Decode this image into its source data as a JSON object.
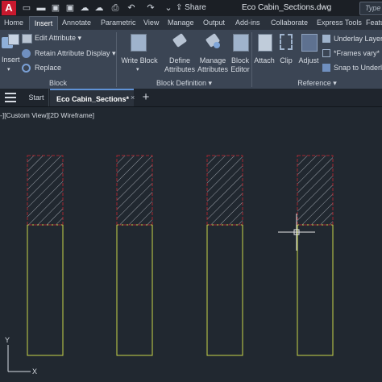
{
  "app": {
    "logo_letter": "A",
    "title": "Eco Cabin_Sections.dwg",
    "share_label": "Share",
    "search_placeholder": "Type a"
  },
  "quick_access": [
    "new-icon",
    "open-icon",
    "save-icon",
    "save-as-icon",
    "cloud-icon",
    "cloud-upload-icon",
    "print-icon",
    "undo-icon",
    "redo-icon",
    "workspace-dropdown-icon"
  ],
  "ribbon_tabs": [
    "Home",
    "Insert",
    "Annotate",
    "Parametric",
    "View",
    "Manage",
    "Output",
    "Add-ins",
    "Collaborate",
    "Express Tools",
    "Featu"
  ],
  "active_tab": "Insert",
  "ribbon": {
    "block_panel": {
      "title": "Block",
      "insert_label": "Insert",
      "edit_attribute": "Edit Attribute",
      "retain_attribute_display": "Retain Attribute Display",
      "replace": "Replace"
    },
    "block_definition_panel": {
      "title": "Block Definition",
      "write_block": "Write Block",
      "define_attributes_1": "Define",
      "define_attributes_2": "Attributes",
      "manage_attributes_1": "Manage",
      "manage_attributes_2": "Attributes",
      "block_editor_1": "Block",
      "block_editor_2": "Editor"
    },
    "reference_panel": {
      "title": "Reference",
      "attach": "Attach",
      "clip": "Clip",
      "adjust": "Adjust",
      "underlay_layers": "Underlay Layers",
      "frames_vary": "*Frames vary*",
      "snap_to_underlays": "Snap to Underla"
    }
  },
  "file_tabs": {
    "start": "Start",
    "document": "Eco Cabin_Sections*",
    "close": "×",
    "new": "+"
  },
  "viewport": {
    "label": "-][Custom View][2D Wireframe]",
    "ucs_y": "Y",
    "ucs_x": "X"
  },
  "colors": {
    "hatch": "#a3262f",
    "column_outline": "#c9d64a",
    "background": "#212830",
    "crosshair": "#e8e8e8"
  },
  "drawing": {
    "columns": [
      {
        "name": "column-1"
      },
      {
        "name": "column-2"
      },
      {
        "name": "column-3"
      },
      {
        "name": "column-4"
      }
    ]
  }
}
